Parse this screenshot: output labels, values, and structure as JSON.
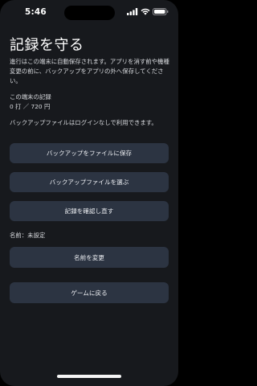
{
  "status_bar": {
    "time": "5:46",
    "icons": [
      "cellular-signal-icon",
      "wifi-icon",
      "battery-icon"
    ]
  },
  "page": {
    "title": "記録を守る",
    "description": "進行はこの端末に自動保存されます。アプリを消す前や機種変更の前に、バックアップをアプリの外へ保存してください。",
    "record_label": "この端末の記録",
    "record_value": "0 打 ／ 720 円",
    "login_note": "バックアップファイルはログインなしで利用できます。",
    "name_line": "名前：未設定"
  },
  "buttons": {
    "save_backup": "バックアップをファイルに保存",
    "choose_backup": "バックアップファイルを選ぶ",
    "review_records": "記録を確認し直す",
    "rename": "名前を変更",
    "back_to_game": "ゲームに戻る"
  },
  "colors": {
    "background": "#17191d",
    "button": "#2c3442",
    "text": "#f2f3f5"
  }
}
